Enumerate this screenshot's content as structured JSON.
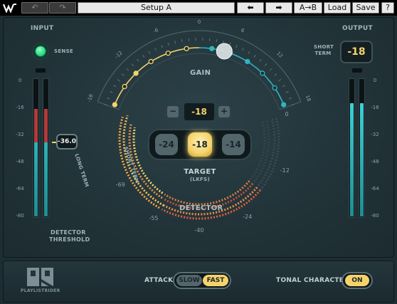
{
  "topbar": {
    "undo_icon": "undo-icon",
    "redo_icon": "redo-icon",
    "preset_name": "Setup A",
    "prev_icon": "arrow-left-icon",
    "next_icon": "arrow-right-icon",
    "ab_label": "A→B",
    "load_label": "Load",
    "save_label": "Save",
    "help_label": "?"
  },
  "input": {
    "title": "INPUT",
    "sense_label": "SENSE",
    "detector_threshold_value": "-36.0",
    "detector_threshold_label_1": "DETECTOR",
    "detector_threshold_label_2": "THRESHOLD",
    "scale": [
      "0",
      "-16",
      "-32",
      "-48",
      "-64",
      "-80"
    ],
    "meter_left_level": 0.58,
    "meter_right_level": 0.58
  },
  "output": {
    "title": "OUTPUT",
    "short_term_label_1": "SHORT",
    "short_term_label_2": "TERM",
    "short_term_value": "-18",
    "scale": [
      "0",
      "-16",
      "-32",
      "-48",
      "-64",
      "-80"
    ],
    "meter_left_level": 0.82,
    "meter_right_level": 0.82
  },
  "gain": {
    "label": "GAIN",
    "value": "-18",
    "minus_label": "−",
    "plus_label": "+",
    "scale": [
      "-18",
      "-12",
      "-6",
      "0",
      "6",
      "12",
      "18"
    ]
  },
  "target": {
    "label": "TARGET",
    "unit": "(LKFS)",
    "options": [
      "-24",
      "-18",
      "-14"
    ],
    "selected": "-18"
  },
  "detector": {
    "label": "DETECTOR",
    "long_term_label": "LONG TERM",
    "short_term_label": "SHORT TERM",
    "scale": [
      "0",
      "-12",
      "-24",
      "-40",
      "-55",
      "-69"
    ]
  },
  "bottom": {
    "brand": "PLAYLISTRIDER",
    "attack_label": "ATTACK",
    "attack_options": [
      "SLOW",
      "FAST"
    ],
    "attack_selected": "FAST",
    "tonal_label": "TONAL CHARACTER",
    "tonal_value": "ON"
  },
  "colors": {
    "accent_yellow": "#f5d36b",
    "accent_teal": "#2fb6bd",
    "meter_red": "#d04a4a",
    "sense_green": "#2fe08a"
  }
}
